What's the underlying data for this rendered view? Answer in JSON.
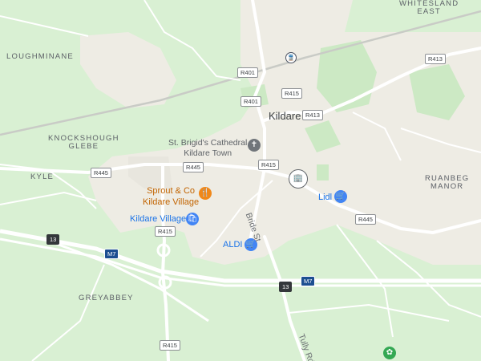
{
  "areas": {
    "loughminane": "LOUGHMINANE",
    "whiteslandEast": "WHITESLAND\nEAST",
    "knockshoughGlebe": "KNOCKSHOUGH\nGLEBE",
    "kyle": "KYLE",
    "ruanbegManor": "RUANBEG\nMANOR",
    "greyabbey": "GREYABBEY"
  },
  "town": "Kildare",
  "pois": {
    "cathedral": "St. Brigid's Cathedral\nKildare Town",
    "sprout": "Sprout & Co\nKildare Village",
    "kildareVillage": "Kildare Village",
    "lidl": "Lidl",
    "aldi": "ALDI"
  },
  "streets": {
    "brideSt": "Bride St",
    "tullyRd": "Tully Rd"
  },
  "shields": {
    "r401a": "R401",
    "r401b": "R401",
    "r415a": "R415",
    "r413a": "R413",
    "r413b": "R413",
    "r445a": "R445",
    "r445b": "R445",
    "r415b": "R415",
    "r445c": "R445",
    "r415c": "R415",
    "r415d": "R415",
    "m7a": "M7",
    "m7b": "M7",
    "n13a": "13",
    "n13b": "13"
  },
  "icons": {
    "cathedral": "church-icon",
    "restaurant": "restaurant-icon",
    "shopping": "shopping-icon",
    "cart": "cart-icon",
    "station": "train-station-icon",
    "building": "building-icon",
    "park": "park-icon"
  },
  "colors": {
    "land": "#d9f0d3",
    "urban": "#eeece4",
    "road": "#ffffff",
    "poiBlue": "#1a73e8",
    "poiOrange": "#c26401",
    "motorwayShield": "#1d4f91"
  }
}
